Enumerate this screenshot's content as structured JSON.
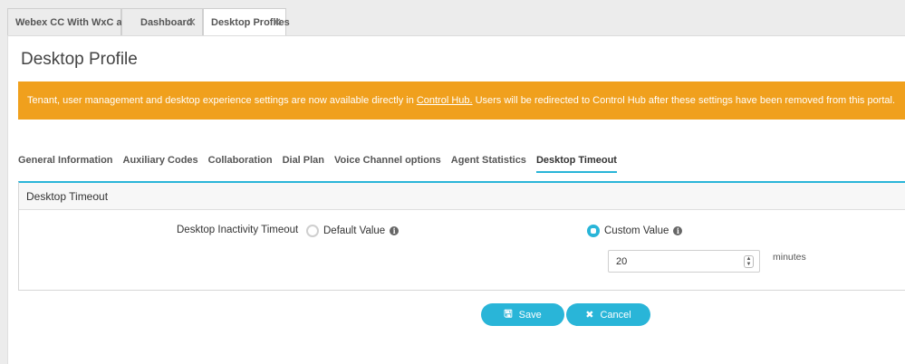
{
  "tabs": [
    {
      "label": "Webex CC With WxC as PBX",
      "closable": false
    },
    {
      "label": "Dashboard",
      "closable": true
    },
    {
      "label": "Desktop Profiles",
      "closable": true,
      "active": true
    }
  ],
  "page": {
    "title": "Desktop Profile"
  },
  "banner": {
    "text_before": "Tenant, user management and desktop experience settings are now available directly in",
    "link": "Control Hub.",
    "text_after": "Users will be redirected to Control Hub after these settings have been removed from this portal.",
    "color": "#f0a01d"
  },
  "subtabs": [
    {
      "label": "General Information"
    },
    {
      "label": "Auxiliary Codes"
    },
    {
      "label": "Collaboration"
    },
    {
      "label": "Dial Plan"
    },
    {
      "label": "Voice Channel options"
    },
    {
      "label": "Agent Statistics"
    },
    {
      "label": "Desktop Timeout",
      "active": true
    }
  ],
  "section": {
    "title": "Desktop Timeout",
    "field_label": "Desktop Inactivity Timeout",
    "options": [
      {
        "label": "Default Value",
        "selected": false,
        "icon": "info-icon"
      },
      {
        "label": "Custom Value",
        "selected": true,
        "icon": "info-icon"
      }
    ],
    "timeout_value": "20",
    "unit": "minutes"
  },
  "buttons": {
    "save": {
      "label": "Save",
      "icon": "save-icon"
    },
    "cancel": {
      "label": "Cancel",
      "icon": "close-icon"
    }
  },
  "accent_color": "#29b5d8"
}
